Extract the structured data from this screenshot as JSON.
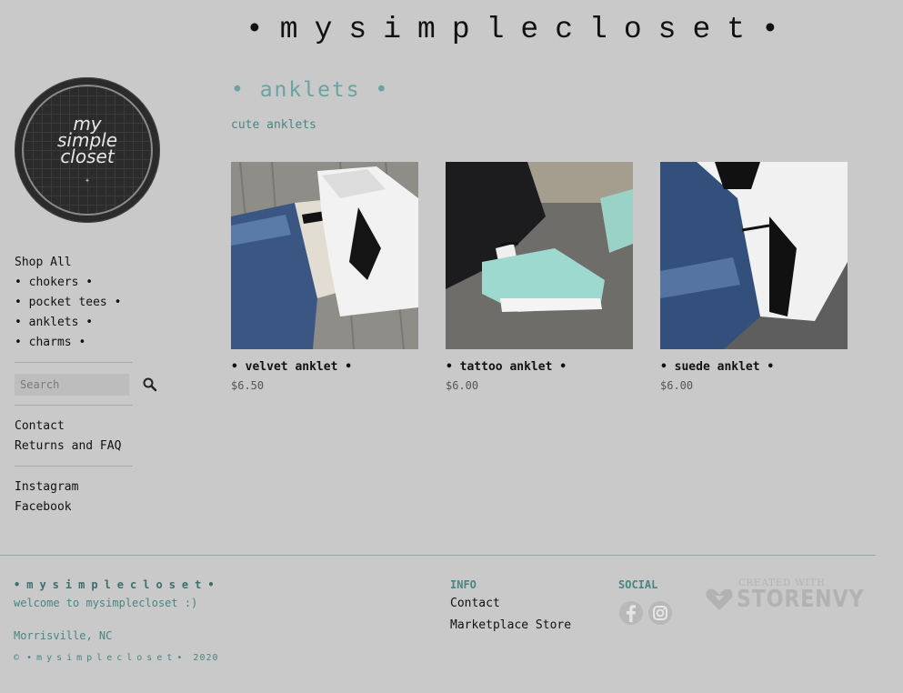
{
  "site": {
    "title": "•mysimplecloset•"
  },
  "logo": {
    "line1": "my",
    "line2": "simple",
    "line3": "closet"
  },
  "sidebar": {
    "nav": [
      {
        "label": "Shop All"
      },
      {
        "label": "• chokers •"
      },
      {
        "label": "• pocket tees •"
      },
      {
        "label": "• anklets •"
      },
      {
        "label": "• charms •"
      }
    ],
    "search": {
      "placeholder": "Search",
      "value": ""
    },
    "info_links": [
      {
        "label": "Contact"
      },
      {
        "label": "Returns and FAQ"
      }
    ],
    "social_links": [
      {
        "label": "Instagram"
      },
      {
        "label": "Facebook"
      }
    ]
  },
  "category": {
    "title": "• anklets •",
    "description": "cute anklets"
  },
  "products": [
    {
      "name": "• velvet anklet •",
      "price": "$6.50"
    },
    {
      "name": "• tattoo anklet •",
      "price": "$6.00"
    },
    {
      "name": "• suede anklet •",
      "price": "$6.00"
    }
  ],
  "footer": {
    "brand": "•mysimplecloset•",
    "welcome": "welcome to mysimplecloset :)",
    "location": "Morrisville, NC",
    "copyright_prefix": "©",
    "copyright_brand": "•mysimplecloset•",
    "copyright_year": "2020",
    "info_heading": "INFO",
    "info_links": [
      {
        "label": "Contact"
      },
      {
        "label": "Marketplace Store"
      }
    ],
    "social_heading": "SOCIAL",
    "social_icons": [
      "facebook-icon",
      "instagram-icon"
    ],
    "storenvy": {
      "small": "CREATED WITH",
      "big": "STORENVY"
    }
  },
  "colors": {
    "background": "#c9c9c9",
    "accent": "#6aa3a1",
    "accent_dark": "#4a8583"
  }
}
